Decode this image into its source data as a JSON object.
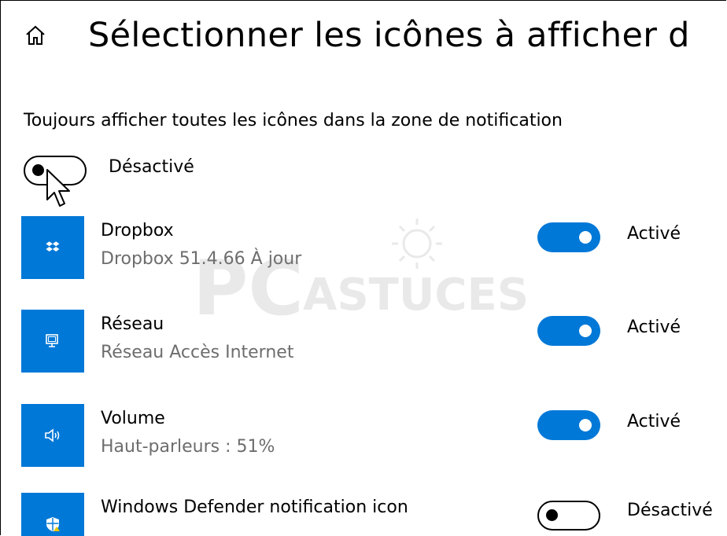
{
  "header": {
    "title": "Sélectionner les icônes à afficher d",
    "home_icon": "home-icon"
  },
  "master": {
    "label": "Toujours afficher toutes les icônes dans la zone de notification",
    "state": "Désactivé",
    "on": false
  },
  "items": [
    {
      "name": "Dropbox",
      "subtitle": "Dropbox 51.4.66 À jour",
      "state": "Activé",
      "on": true,
      "icon": "dropbox-icon"
    },
    {
      "name": "Réseau",
      "subtitle": "Réseau Accès Internet",
      "state": "Activé",
      "on": true,
      "icon": "network-icon"
    },
    {
      "name": "Volume",
      "subtitle": "Haut-parleurs : 51%",
      "state": "Activé",
      "on": true,
      "icon": "volume-icon"
    },
    {
      "name": "Windows Defender notification icon",
      "subtitle": "",
      "state": "Désactivé",
      "on": false,
      "icon": "shield-icon"
    }
  ],
  "watermark": {
    "top": "PC",
    "bottom": "ASTUCES"
  },
  "colors": {
    "accent": "#0078d7",
    "secondary_text": "#6d6d6d"
  }
}
